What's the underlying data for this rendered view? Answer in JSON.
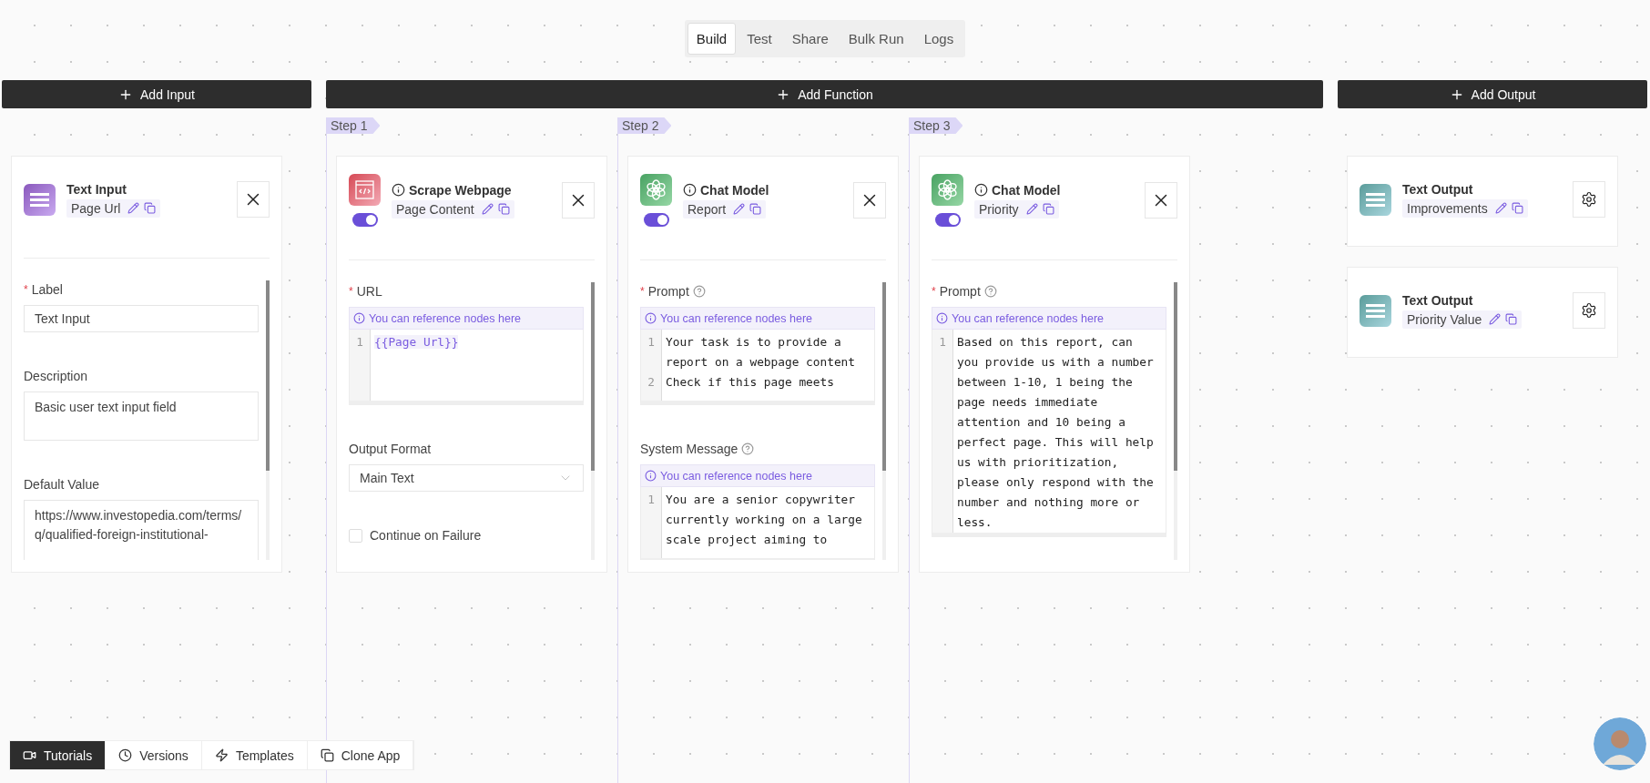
{
  "view_tabs": [
    {
      "label": "Build",
      "selected": true
    },
    {
      "label": "Test",
      "selected": false
    },
    {
      "label": "Share",
      "selected": false
    },
    {
      "label": "Bulk Run",
      "selected": false
    },
    {
      "label": "Logs",
      "selected": false
    }
  ],
  "input_column": {
    "button": "Add Input",
    "nodes": [
      {
        "kind": "text_input",
        "title": "Text Input",
        "label": "Page Url",
        "info": false,
        "fields": [
          {
            "kind": "text",
            "marker": "*",
            "label": "Label",
            "value": "Text Input"
          },
          {
            "kind": "textarea",
            "label": "Description",
            "value": "Basic user text input field"
          },
          {
            "kind": "textarea",
            "label": "Default Value",
            "value": "https://www.investopedia.com/terms/q/qualified-foreign-institutional-"
          }
        ]
      }
    ]
  },
  "function_column": {
    "button": "Add Function",
    "steps": [
      {
        "label": "Step 1",
        "node": {
          "kind": "scrape",
          "title": "Scrape Webpage",
          "label": "Page Content",
          "info": true,
          "enabled": true,
          "fields": [
            {
              "kind": "code",
              "marker": "*",
              "label": "URL",
              "help": false,
              "hint": "You can reference nodes here",
              "lines": [
                {
                  "number": "1",
                  "text": "{{Page Url}}",
                  "reference": true
                }
              ]
            },
            {
              "kind": "select",
              "label": "Output Format",
              "value": "Main Text"
            },
            {
              "kind": "checkbox",
              "label": "Continue on Failure",
              "checked": false
            }
          ]
        }
      },
      {
        "label": "Step 2",
        "node": {
          "kind": "chat",
          "title": "Chat Model",
          "label": "Report",
          "info": true,
          "enabled": true,
          "fields": [
            {
              "kind": "code",
              "marker": "*",
              "label": "Prompt",
              "help": true,
              "hint": "You can reference nodes here",
              "lines": [
                {
                  "number": "1",
                  "text": "Your task is to provide a report on a webpage content",
                  "reference": false
                },
                {
                  "number": "2",
                  "text": "Check if this page meets",
                  "reference": false
                }
              ]
            },
            {
              "kind": "code",
              "label": "System Message",
              "help": true,
              "hint": "You can reference nodes here",
              "lines": [
                {
                  "number": "1",
                  "text": "You are a senior copywriter currently working on a large scale project aiming to",
                  "reference": false
                }
              ]
            }
          ]
        }
      },
      {
        "label": "Step 3",
        "node": {
          "kind": "chat",
          "title": "Chat Model",
          "label": "Priority",
          "info": true,
          "enabled": true,
          "fields": [
            {
              "kind": "code",
              "marker": "*",
              "label": "Prompt",
              "help": true,
              "hint": "You can reference nodes here",
              "lines": [
                {
                  "number": "1",
                  "text": "Based on this report, can you provide us with a number between 1-10, 1 being the page needs immediate attention and 10 being a perfect page. This will help us with prioritization, please only respond with the number and nothing more or less.",
                  "reference": false
                }
              ]
            }
          ]
        }
      }
    ]
  },
  "output_column": {
    "button": "Add Output",
    "nodes": [
      {
        "kind": "text_output",
        "title": "Text Output",
        "label": "Improvements",
        "info": false
      },
      {
        "kind": "text_output",
        "title": "Text Output",
        "label": "Priority Value",
        "info": false
      }
    ]
  },
  "bottom_bar": [
    {
      "kind": "video",
      "label": "Tutorials",
      "selected": true
    },
    {
      "kind": "clock",
      "label": "Versions",
      "selected": false
    },
    {
      "kind": "bolt",
      "label": "Templates",
      "selected": false
    },
    {
      "kind": "copy",
      "label": "Clone App",
      "selected": false
    }
  ]
}
